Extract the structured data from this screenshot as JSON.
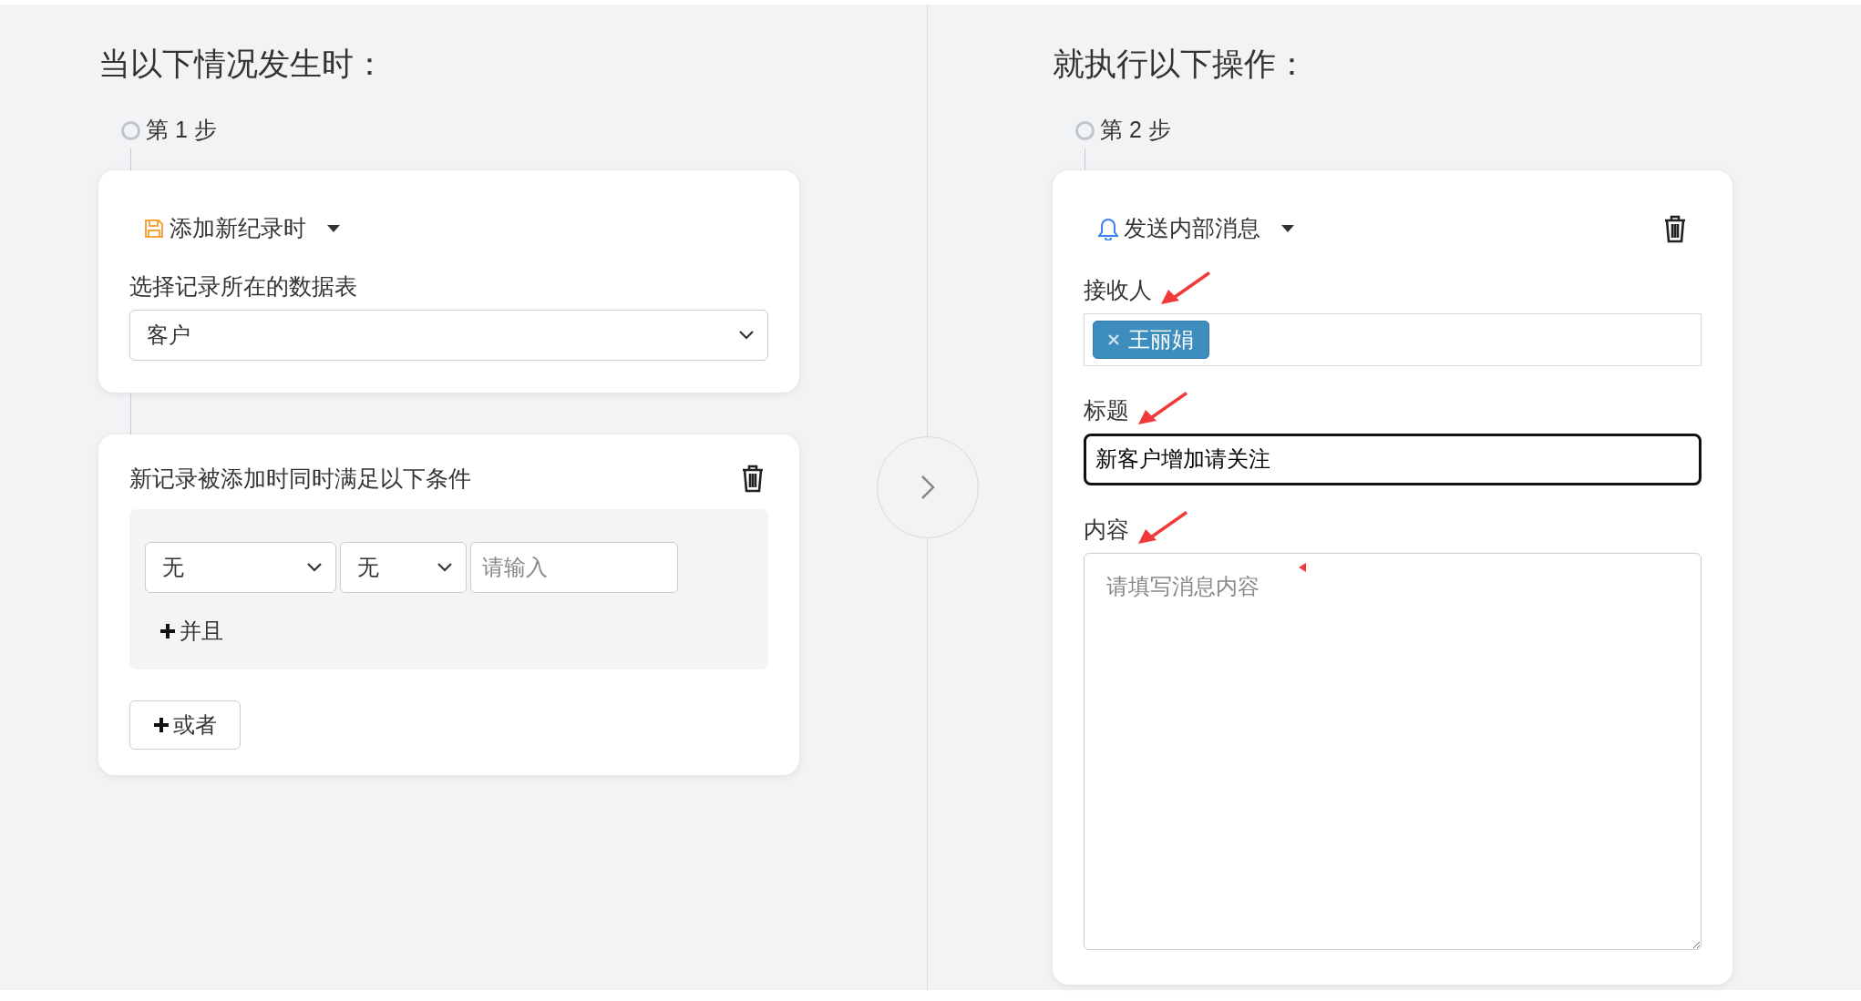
{
  "trigger": {
    "heading": "当以下情况发生时：",
    "step": "第 1 步",
    "event_card": {
      "event": "添加新纪录时",
      "field_label": "选择记录所在的数据表",
      "table_select": "客户"
    },
    "conditions_card": {
      "title": "新记录被添加时同时满足以下条件",
      "rows": [
        {
          "field": "无",
          "operator": "无",
          "value_placeholder": "请输入"
        }
      ],
      "and_button": "并且",
      "or_button": "或者"
    }
  },
  "action": {
    "heading": "就执行以下操作：",
    "step": "第 2 步",
    "event": "发送内部消息",
    "fields": [
      {
        "kind": "tags",
        "label": "接收人",
        "tags": [
          "王丽娟"
        ],
        "focused": false
      },
      {
        "kind": "text",
        "label": "标题",
        "value": "新客户增加请关注",
        "focused": true
      },
      {
        "kind": "textarea",
        "label": "内容",
        "placeholder": "请填写消息内容",
        "focused": false
      }
    ]
  }
}
